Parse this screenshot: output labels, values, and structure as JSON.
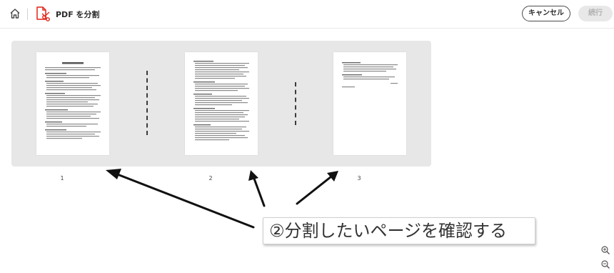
{
  "header": {
    "title": "PDF を分割",
    "cancel_label": "キャンセル",
    "continue_label": "続行"
  },
  "pages": [
    {
      "number": "1"
    },
    {
      "number": "2"
    },
    {
      "number": "3"
    }
  ],
  "annotation": {
    "text": "②分割したいページを確認する"
  },
  "colors": {
    "accent_red": "#e1251b",
    "stage_bg": "#e7e7e7"
  },
  "icons": {
    "home": "home-icon",
    "tool": "split-pdf-icon",
    "zoom_in": "zoom-in-icon",
    "zoom_out": "zoom-out-icon"
  }
}
